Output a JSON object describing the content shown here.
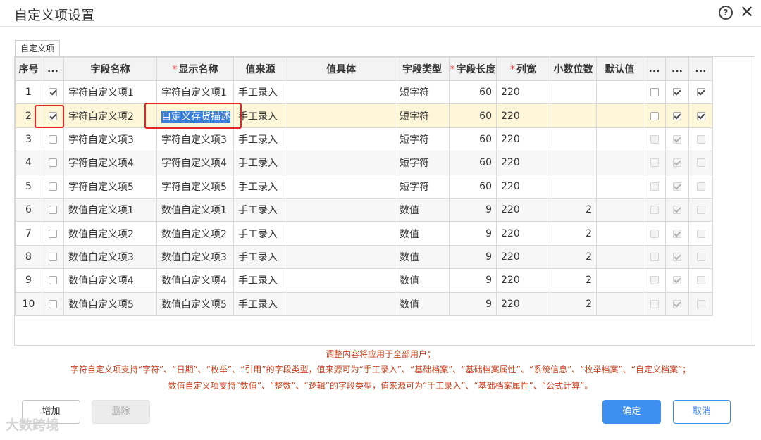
{
  "window": {
    "title": "自定义项设置"
  },
  "tab": {
    "label": "自定义项"
  },
  "table": {
    "headers": [
      "序号",
      "...",
      "字段名称",
      "显示名称",
      "值来源",
      "值具体",
      "字段类型",
      "字段长度",
      "列宽",
      "小数位数",
      "默认值",
      "...",
      "...",
      "..."
    ],
    "required_mark": "*",
    "rows": [
      {
        "no": "1",
        "checked": true,
        "field_name": "字符自定义项1",
        "display_name": "字符自定义项1",
        "source": "手工录入",
        "detail": "",
        "type": "短字符",
        "length": "60",
        "width": "220",
        "decimals": "",
        "default": "",
        "c1": false,
        "c2": true,
        "c3": true
      },
      {
        "no": "2",
        "checked": true,
        "field_name": "字符自定义项2",
        "display_name": "自定义存货描述",
        "source": "手工录入",
        "detail": "",
        "type": "短字符",
        "length": "60",
        "width": "220",
        "decimals": "",
        "default": "",
        "c1": false,
        "c2": true,
        "c3": true
      },
      {
        "no": "3",
        "checked": false,
        "field_name": "字符自定义项3",
        "display_name": "字符自定义项3",
        "source": "手工录入",
        "detail": "",
        "type": "短字符",
        "length": "60",
        "width": "220",
        "decimals": "",
        "default": "",
        "c1": false,
        "c2": true,
        "c3": false
      },
      {
        "no": "4",
        "checked": false,
        "field_name": "字符自定义项4",
        "display_name": "字符自定义项4",
        "source": "手工录入",
        "detail": "",
        "type": "短字符",
        "length": "60",
        "width": "220",
        "decimals": "",
        "default": "",
        "c1": false,
        "c2": true,
        "c3": false
      },
      {
        "no": "5",
        "checked": false,
        "field_name": "字符自定义项5",
        "display_name": "字符自定义项5",
        "source": "手工录入",
        "detail": "",
        "type": "短字符",
        "length": "60",
        "width": "220",
        "decimals": "",
        "default": "",
        "c1": false,
        "c2": true,
        "c3": false
      },
      {
        "no": "6",
        "checked": false,
        "field_name": "数值自定义项1",
        "display_name": "数值自定义项1",
        "source": "手工录入",
        "detail": "",
        "type": "数值",
        "length": "9",
        "width": "220",
        "decimals": "2",
        "default": "",
        "c1": false,
        "c2": true,
        "c3": false
      },
      {
        "no": "7",
        "checked": false,
        "field_name": "数值自定义项2",
        "display_name": "数值自定义项2",
        "source": "手工录入",
        "detail": "",
        "type": "数值",
        "length": "9",
        "width": "220",
        "decimals": "2",
        "default": "",
        "c1": false,
        "c2": true,
        "c3": false
      },
      {
        "no": "8",
        "checked": false,
        "field_name": "数值自定义项3",
        "display_name": "数值自定义项3",
        "source": "手工录入",
        "detail": "",
        "type": "数值",
        "length": "9",
        "width": "220",
        "decimals": "2",
        "default": "",
        "c1": false,
        "c2": true,
        "c3": false
      },
      {
        "no": "9",
        "checked": false,
        "field_name": "数值自定义项4",
        "display_name": "数值自定义项4",
        "source": "手工录入",
        "detail": "",
        "type": "数值",
        "length": "9",
        "width": "220",
        "decimals": "2",
        "default": "",
        "c1": false,
        "c2": true,
        "c3": false
      },
      {
        "no": "10",
        "checked": false,
        "field_name": "数值自定义项5",
        "display_name": "数值自定义项5",
        "source": "手工录入",
        "detail": "",
        "type": "数值",
        "length": "9",
        "width": "220",
        "decimals": "2",
        "default": "",
        "c1": false,
        "c2": true,
        "c3": false
      }
    ]
  },
  "notes": {
    "line1": "调整内容将应用于全部用户；",
    "line2": "字符自定义项支持“字符”、“日期”、“枚举”、“引用”的字段类型，值来源可为“手工录入”、“基础档案”、“基础档案属性”、“系统信息”、“枚举档案”、“自定义档案”；",
    "line3": "数值自定义项支持“数值”、“整数”、“逻辑”的字段类型，值来源可为“手工录入”、“基础档案属性”、“公式计算”。"
  },
  "buttons": {
    "add": "增加",
    "delete": "删除",
    "ok": "确定",
    "cancel": "取消"
  },
  "watermark": "大数跨境",
  "colors": {
    "primary": "#3f8ff0",
    "note": "#c8401d",
    "highlight_box": "#e82424",
    "selected_row": "#fdf6d9"
  }
}
